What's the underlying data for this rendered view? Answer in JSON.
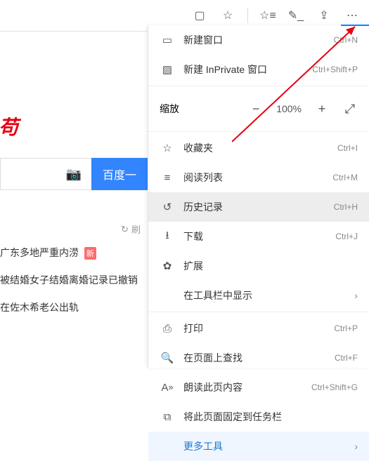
{
  "toolbar": {
    "reading_tip": "阅读视图",
    "favorite_tip": "收藏",
    "fav_list_tip": "收藏夹",
    "note_tip": "笔记",
    "share_tip": "分享",
    "more_tip": "更多"
  },
  "page": {
    "search_button": "百度一",
    "refresh_text": "刷",
    "news1": "广东多地严重内涝",
    "news1_badge": "新",
    "news2": "被结婚女子结婚离婚记录已撤销",
    "news3": "在佐木希老公出轨"
  },
  "menu": {
    "new_window": "新建窗口",
    "new_window_sc": "Ctrl+N",
    "new_inprivate": "新建 InPrivate 窗口",
    "new_inprivate_sc": "Ctrl+Shift+P",
    "zoom_label": "缩放",
    "zoom_value": "100%",
    "favorites": "收藏夹",
    "favorites_sc": "Ctrl+I",
    "reading_list": "阅读列表",
    "reading_list_sc": "Ctrl+M",
    "history": "历史记录",
    "history_sc": "Ctrl+H",
    "downloads": "下载",
    "downloads_sc": "Ctrl+J",
    "extensions": "扩展",
    "show_in_toolbar": "在工具栏中显示",
    "print": "打印",
    "print_sc": "Ctrl+P",
    "find": "在页面上查找",
    "find_sc": "Ctrl+F",
    "read_aloud": "朗读此页内容",
    "read_aloud_sc": "Ctrl+Shift+G",
    "pin_taskbar": "将此页面固定到任务栏",
    "more_tools": "更多工具"
  }
}
